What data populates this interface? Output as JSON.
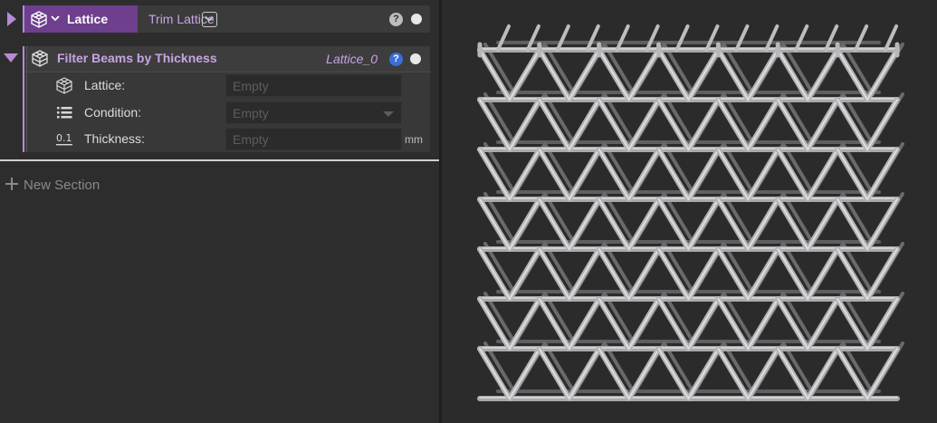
{
  "top_block": {
    "type_label": "Lattice",
    "name": "Trim Lattice",
    "help": "?"
  },
  "filter_block": {
    "title": "Filter Beams by Thickness",
    "target": "Lattice_0",
    "help": "?"
  },
  "params": [
    {
      "icon": "lattice-cube-icon",
      "label": "Lattice:",
      "value": "Empty"
    },
    {
      "icon": "list-icon",
      "label": "Condition:",
      "value": "Empty"
    },
    {
      "icon": "number-icon",
      "label": "Thickness:",
      "value": "Empty",
      "unit": "mm"
    }
  ],
  "new_section": {
    "label": "New Section"
  },
  "viewport": {
    "content": "lattice-3d-render"
  },
  "colors": {
    "accent_purple": "#6d3f8c",
    "label_purple": "#c7a4e2",
    "help_blue": "#3a6fd8"
  }
}
